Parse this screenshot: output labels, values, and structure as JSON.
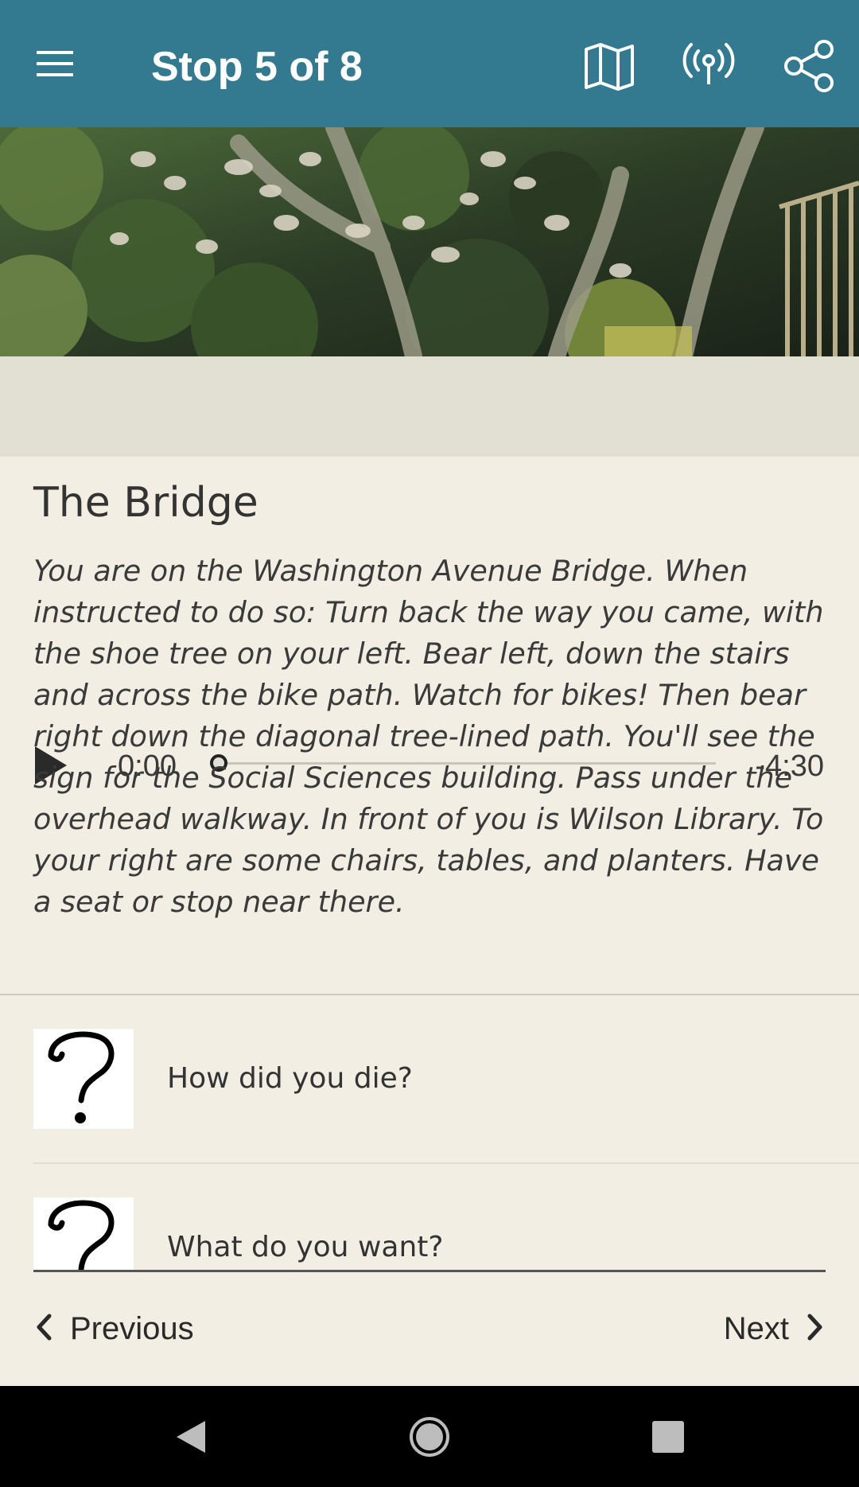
{
  "app_bar": {
    "title": "Stop 5 of 8",
    "color": "#337a90",
    "icons": [
      "menu-icon",
      "map-icon",
      "beacon-icon",
      "share-icon"
    ]
  },
  "hero": {
    "icon": "shoe-tree-photo"
  },
  "player": {
    "elapsed": "0:00",
    "remaining": "-4:30",
    "progress": 0
  },
  "stop": {
    "title": "The Bridge",
    "description": "You are on the Washington Avenue Bridge. When instructed to do so: Turn back the way you came, with the shoe tree on your left. Bear left, down the stairs and across the bike path. Watch for bikes! Then bear right down the diagonal tree-lined path. You'll see the sign for the Social Sciences building. Pass under the overhead walkway. In front of you is Wilson Library. To your right are some chairs, tables, and planters. Have a seat or stop near there."
  },
  "questions": [
    {
      "label": "How did you die?",
      "icon": "question-mark-icon"
    },
    {
      "label": "What do you want?",
      "icon": "question-mark-icon"
    }
  ],
  "nav": {
    "previous": "Previous",
    "next": "Next"
  }
}
